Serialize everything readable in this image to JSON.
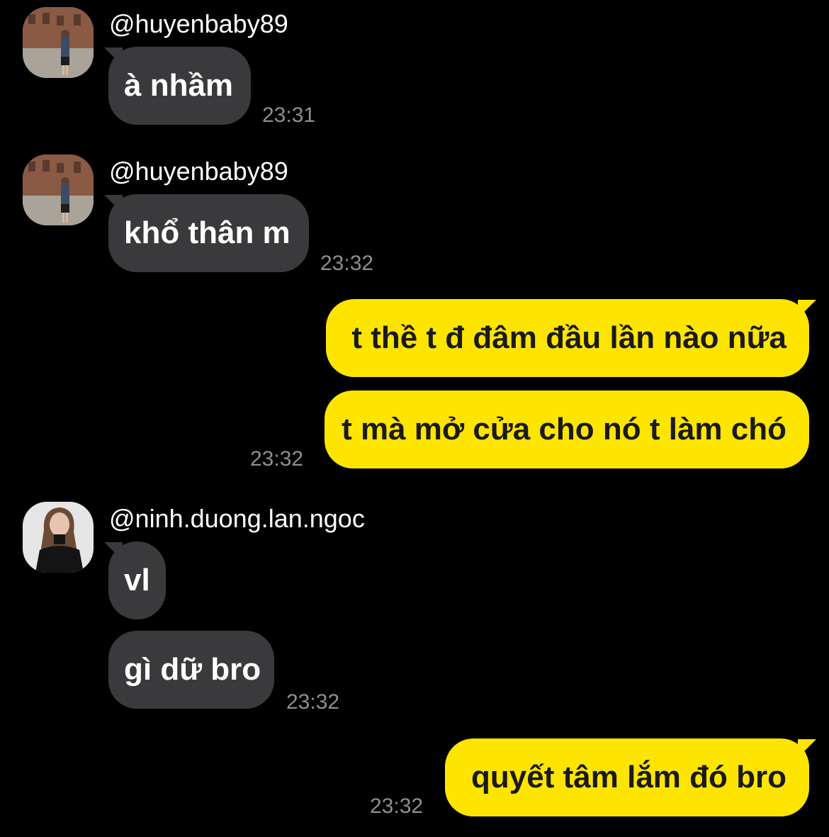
{
  "colors": {
    "background": "#000000",
    "incoming_bubble": "#3a3a3c",
    "outgoing_bubble": "#fee500",
    "timestamp": "#8e8e93"
  },
  "messages": [
    {
      "sender": "@huyenbaby89",
      "text": "à nhầm",
      "time": "23:31"
    },
    {
      "sender": "@huyenbaby89",
      "text": "khổ thân m",
      "time": "23:32"
    },
    {
      "text": "t thề t đ đâm đầu lần nào nữa"
    },
    {
      "text": "t mà mở cửa cho nó t làm chó",
      "time": "23:32"
    },
    {
      "sender": "@ninh.duong.lan.ngoc",
      "text": "vl"
    },
    {
      "text": "gì dữ bro",
      "time": "23:32"
    },
    {
      "text": "quyết tâm lắm đó bro",
      "time": "23:32"
    }
  ]
}
